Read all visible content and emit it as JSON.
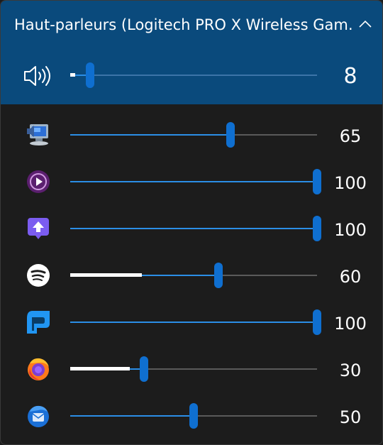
{
  "device": {
    "title": "Haut-parleurs (Logitech PRO X Wireless Gam…",
    "volume": 8,
    "peak_level": 0.02
  },
  "apps": [
    {
      "icon": "system-sounds-icon",
      "volume": 65,
      "peak_level": 0.0
    },
    {
      "icon": "media-player-icon",
      "volume": 100,
      "peak_level": 0.0
    },
    {
      "icon": "upload-app-icon",
      "volume": 100,
      "peak_level": 0.0
    },
    {
      "icon": "spotify-icon",
      "volume": 60,
      "peak_level": 0.29
    },
    {
      "icon": "app-p-icon",
      "volume": 100,
      "peak_level": 0.0
    },
    {
      "icon": "firefox-icon",
      "volume": 30,
      "peak_level": 0.24
    },
    {
      "icon": "thunderbird-icon",
      "volume": 50,
      "peak_level": 0.0
    }
  ],
  "colors": {
    "header_bg": "#0a4a7c",
    "panel_bg": "#1c1c1c",
    "accent": "#0f6fd0",
    "fill": "#2b8ee6"
  }
}
